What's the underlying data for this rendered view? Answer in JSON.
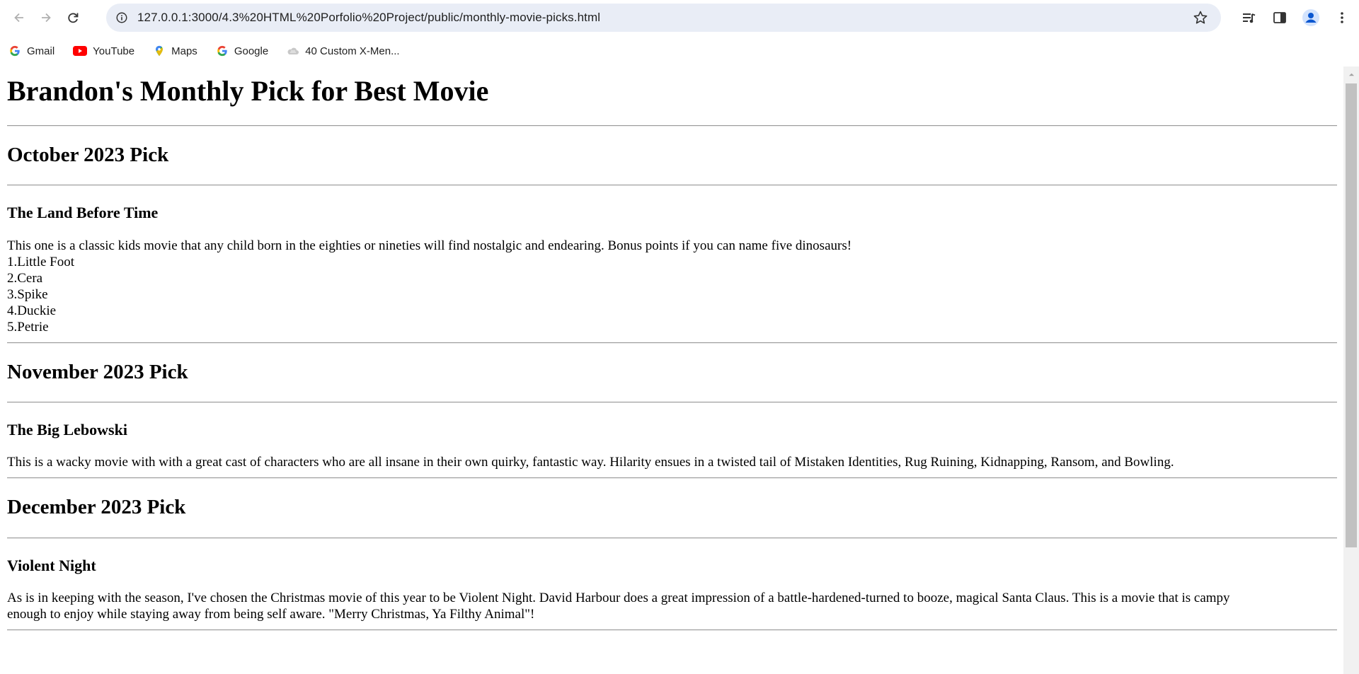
{
  "browser": {
    "url": "127.0.0.1:3000/4.3%20HTML%20Porfolio%20Project/public/monthly-movie-picks.html",
    "bookmarks": [
      {
        "label": "Gmail",
        "icon": "google-icon"
      },
      {
        "label": "YouTube",
        "icon": "youtube-icon"
      },
      {
        "label": "Maps",
        "icon": "maps-icon"
      },
      {
        "label": "Google",
        "icon": "google-icon"
      },
      {
        "label": "40 Custom X-Men...",
        "icon": "cloud-icon"
      }
    ],
    "colors": {
      "omnibox_bg": "#e9edf6",
      "profile_accent": "#0b57d0"
    }
  },
  "page": {
    "title": "Brandon's Monthly Pick for Best Movie",
    "sections": [
      {
        "month": "October 2023 Pick",
        "movie": "The Land Before Time",
        "description": "This one is a classic kids movie that any child born in the eighties or nineties will find nostalgic and endearing. Bonus points if you can name five dinosaurs!",
        "list": [
          "1.Little Foot",
          "2.Cera",
          "3.Spike",
          "4.Duckie",
          "5.Petrie"
        ]
      },
      {
        "month": "November 2023 Pick",
        "movie": "The Big Lebowski",
        "description": "This is a wacky movie with with a great cast of characters who are all insane in their own quirky, fantastic way. Hilarity ensues in a twisted tail of Mistaken Identities, Rug Ruining, Kidnapping, Ransom, and Bowling."
      },
      {
        "month": "December 2023 Pick",
        "movie": "Violent Night",
        "description_line1": "As is in keeping with the season, I've chosen the Christmas movie of this year to be Violent Night. David Harbour does a great impression of a battle-hardened-turned to booze, magical Santa Claus. This is a movie that is campy",
        "description_line2": "enough to enjoy while staying away from being self aware. \"Merry Christmas, Ya Filthy Animal\"!"
      }
    ]
  }
}
